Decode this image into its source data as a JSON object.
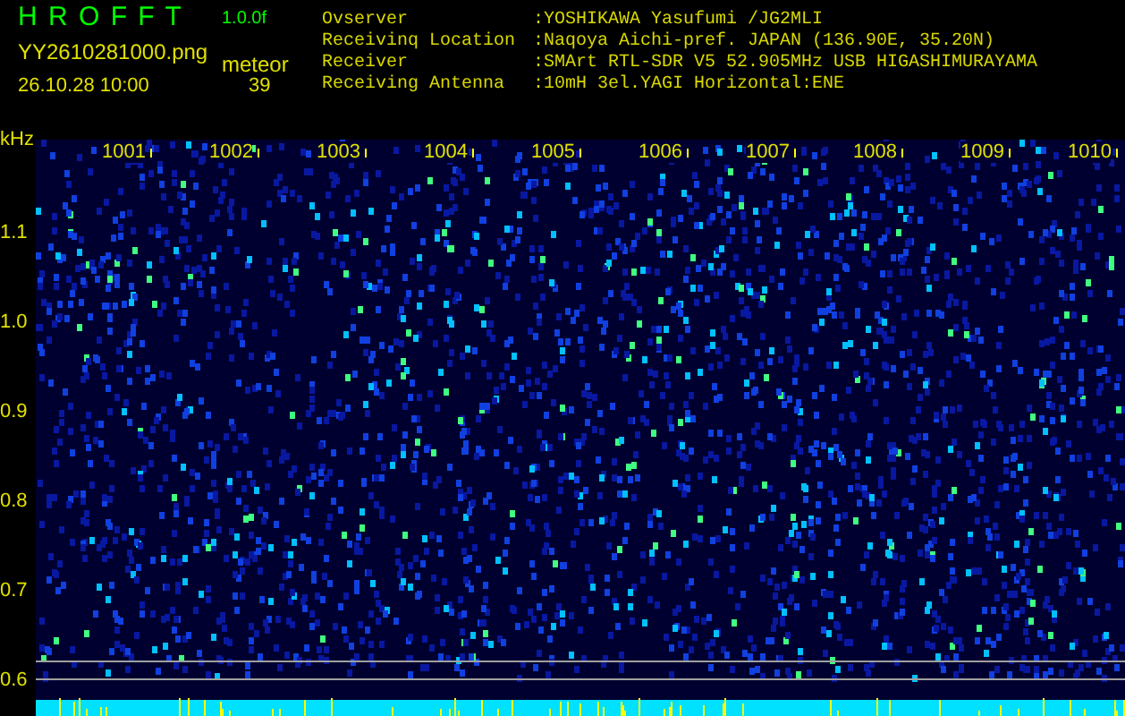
{
  "app": {
    "title": "H R O F F T",
    "version": "1.0.0f"
  },
  "file": {
    "name": "YY2610281000.png",
    "timestamp": "26.10.28 10:00"
  },
  "counter": {
    "label": "meteor",
    "value": "39"
  },
  "info": [
    {
      "label": "Ovserver",
      "value": ":YOSHIKAWA Yasufumi /JG2MLI"
    },
    {
      "label": "Receivinq Location",
      "value": ":Naqoya Aichi-pref. JAPAN (136.90E, 35.20N)"
    },
    {
      "label": "Receiver",
      "value": ":SMArt RTL-SDR V5 52.905MHz USB HIGASHIMURAYAMA"
    },
    {
      "label": "Receiving Antenna",
      "value": ":10mH 3el.YAGI Horizontal:ENE"
    }
  ],
  "spectrogram": {
    "unit": "kHz",
    "x_labels": [
      "1001",
      "1002",
      "1003",
      "1004",
      "1005",
      "1006",
      "1007",
      "1008",
      "1009",
      "1010"
    ],
    "y_labels": [
      "1.1",
      "1.0",
      "0.9",
      "0.8",
      "0.7",
      "0.6"
    ]
  }
}
